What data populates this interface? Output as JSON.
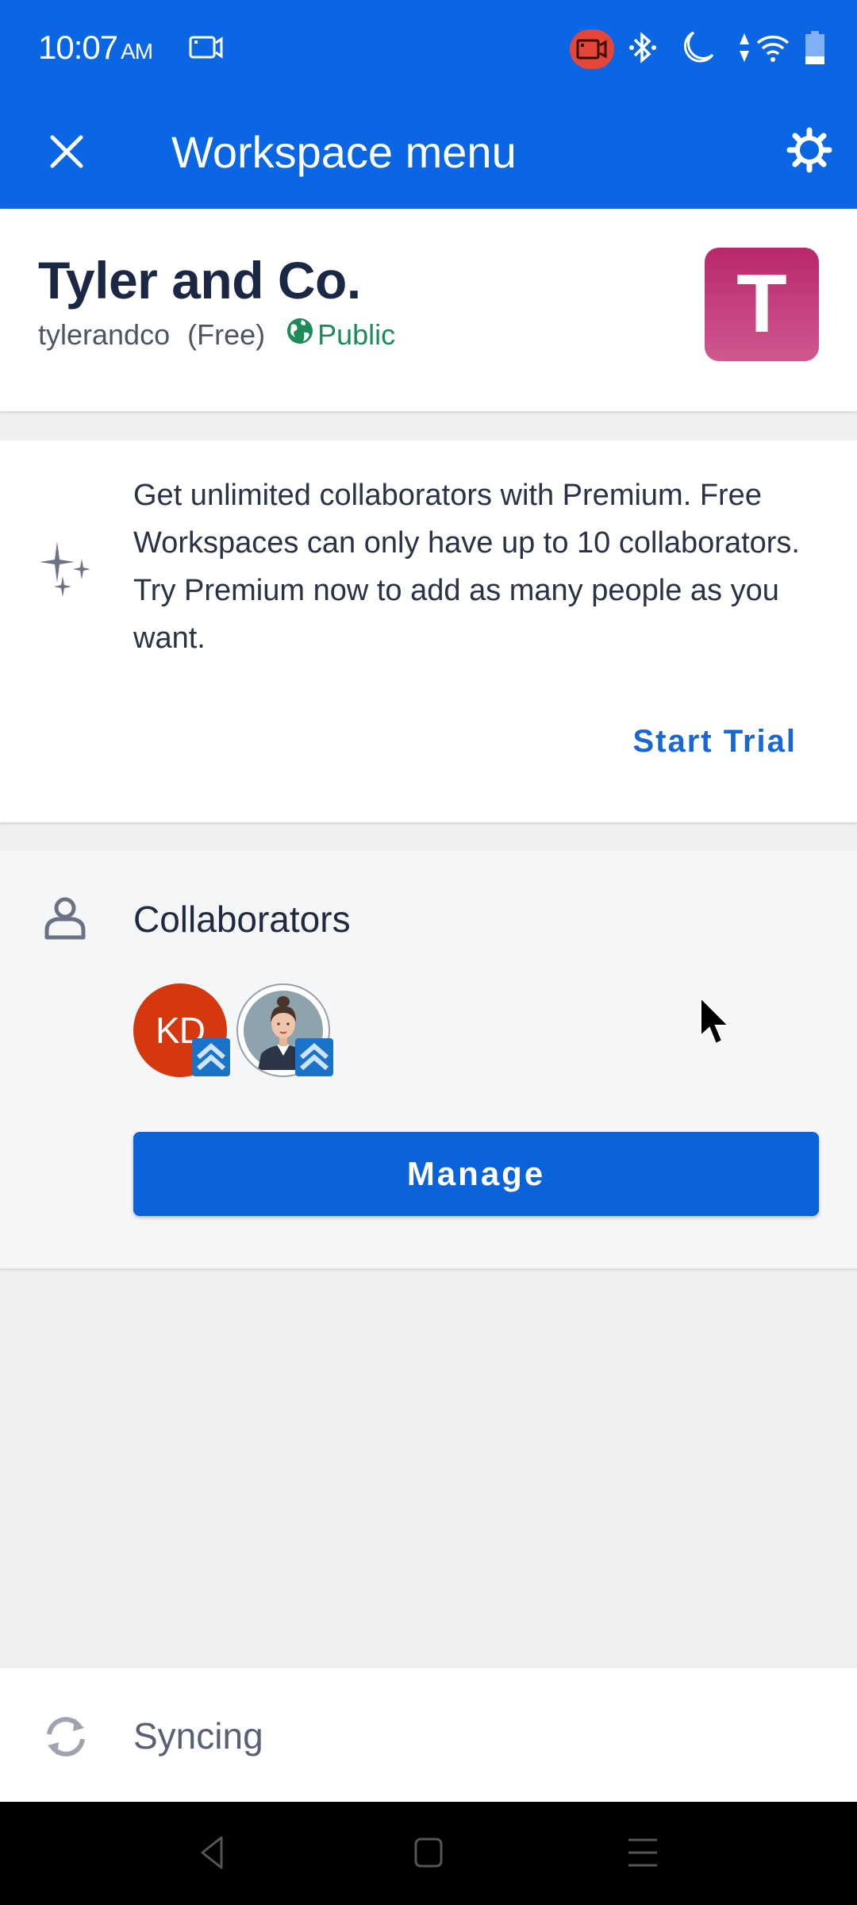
{
  "status_bar": {
    "time": "10:07",
    "ampm": "AM",
    "icons": [
      "screen-record-icon",
      "recording-active-icon",
      "bluetooth-icon",
      "do-not-disturb-moon-icon",
      "data-arrows-icon",
      "wifi-icon",
      "battery-icon"
    ]
  },
  "app_bar": {
    "title": "Workspace menu",
    "close_icon": "close-icon",
    "settings_icon": "gear-icon"
  },
  "workspace": {
    "name": "Tyler and Co.",
    "handle": "tylerandco",
    "plan": "(Free)",
    "visibility": "Public",
    "logo_letter": "T",
    "logo_color_top": "#b8286a",
    "logo_color_bottom": "#d0588f"
  },
  "premium_promo": {
    "icon": "sparkles-icon",
    "text": "Get unlimited collaborators with Premium. Free Workspaces can only have up to 10 collaborators. Try Premium now to add as many people as you want.",
    "action_label": "Start Trial"
  },
  "collaborators": {
    "icon": "person-icon",
    "title": "Collaborators",
    "members": [
      {
        "initials": "KD",
        "type": "initials",
        "color": "#d5370f",
        "badge": "admin-chevrons-icon"
      },
      {
        "initials": "",
        "type": "photo",
        "badge": "admin-chevrons-icon"
      }
    ],
    "manage_label": "Manage"
  },
  "sync": {
    "icon": "sync-icon",
    "label": "Syncing"
  },
  "nav_bar": {
    "buttons": [
      "back",
      "home",
      "recents"
    ]
  },
  "colors": {
    "primary": "#0b66e4",
    "accent_link": "#1a66d4",
    "public_green": "#1e8a5a",
    "badge_blue": "#1a73c8"
  }
}
